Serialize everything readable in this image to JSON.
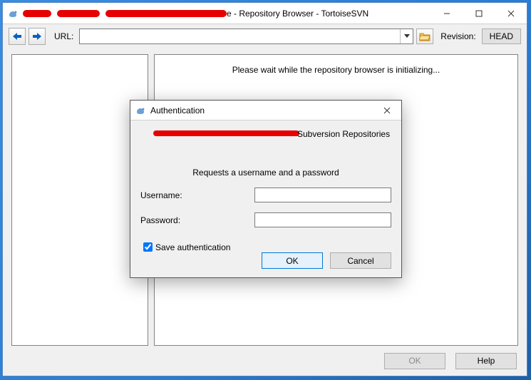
{
  "window": {
    "title_suffix": "e - Repository Browser - TortoiseSVN"
  },
  "toolbar": {
    "back_icon": "arrow-left",
    "fwd_icon": "arrow-right",
    "url_label": "URL:",
    "url_value": "",
    "folder_icon": "open-folder",
    "revision_label": "Revision:",
    "head_label": "HEAD"
  },
  "main": {
    "loading_text": "Please wait while the repository browser is initializing..."
  },
  "footer": {
    "ok_label": "OK",
    "help_label": "Help"
  },
  "auth": {
    "title": "Authentication",
    "repo_suffix": "Subversion Repositories",
    "instruction": "Requests a username and a password",
    "username_label": "Username:",
    "username_value": "",
    "password_label": "Password:",
    "password_value": "",
    "save_label": "Save authentication",
    "save_checked": true,
    "ok_label": "OK",
    "cancel_label": "Cancel"
  }
}
